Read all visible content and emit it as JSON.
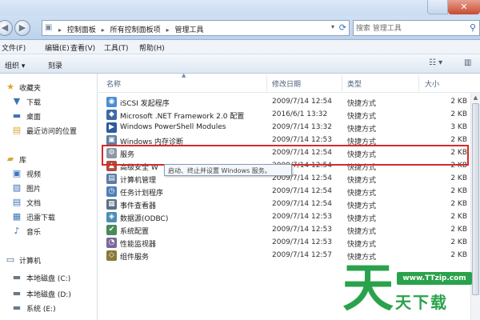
{
  "window": {
    "close_glyph": "✕"
  },
  "address": {
    "crumbs": [
      "控制面板",
      "所有控制面板项",
      "管理工具"
    ],
    "separator": "▸"
  },
  "search": {
    "placeholder": "搜索 管理工具"
  },
  "menu": {
    "items": [
      "文件(F)",
      "编辑(E)",
      "查看(V)",
      "工具(T)",
      "帮助(H)"
    ]
  },
  "commandbar": {
    "organize": "组织 ▾",
    "burn": "刻录"
  },
  "navpane": {
    "favorites": {
      "label": "收藏夹",
      "items": [
        "下载",
        "桌面",
        "最近访问的位置"
      ]
    },
    "libraries": {
      "label": "库",
      "items": [
        "视频",
        "图片",
        "文档",
        "迅雷下载",
        "音乐"
      ]
    },
    "computer": {
      "label": "计算机",
      "items": [
        "本地磁盘 (C:)",
        "本地磁盘 (D:)",
        "系统 (E:)"
      ]
    }
  },
  "columns": {
    "name": "名称",
    "date": "修改日期",
    "type": "类型",
    "size": "大小"
  },
  "files": [
    {
      "name": "iSCSI 发起程序",
      "date": "2009/7/14 12:54",
      "type": "快捷方式",
      "size": "2 KB",
      "icon": "iscsi-icon",
      "color": "#4a8fcf"
    },
    {
      "name": "Microsoft .NET Framework 2.0 配置",
      "date": "2016/6/1 13:32",
      "type": "快捷方式",
      "size": "2 KB",
      "icon": "dotnet-icon",
      "color": "#3e6aa8"
    },
    {
      "name": "Windows PowerShell Modules",
      "date": "2009/7/14 13:32",
      "type": "快捷方式",
      "size": "3 KB",
      "icon": "powershell-icon",
      "color": "#2d5aa0"
    },
    {
      "name": "Windows 内存诊断",
      "date": "2009/7/14 12:53",
      "type": "快捷方式",
      "size": "2 KB",
      "icon": "memory-diagnostic-icon",
      "color": "#5d7f9f"
    },
    {
      "name": "服务",
      "date": "2009/7/14 12:54",
      "type": "快捷方式",
      "size": "2 KB",
      "icon": "services-gear-icon",
      "color": "#8a99a8"
    },
    {
      "name": "高级安全 W",
      "date": "2009/7/14 12:54",
      "type": "快捷方式",
      "size": "2 KB",
      "icon": "firewall-icon",
      "color": "#b34a3a"
    },
    {
      "name": "计算机管理",
      "date": "2009/7/14 12:54",
      "type": "快捷方式",
      "size": "2 KB",
      "icon": "computer-management-icon",
      "color": "#5a7da6"
    },
    {
      "name": "任务计划程序",
      "date": "2009/7/14 12:54",
      "type": "快捷方式",
      "size": "2 KB",
      "icon": "task-scheduler-icon",
      "color": "#4f7fb8"
    },
    {
      "name": "事件查看器",
      "date": "2009/7/14 12:54",
      "type": "快捷方式",
      "size": "2 KB",
      "icon": "event-viewer-icon",
      "color": "#5b6f86"
    },
    {
      "name": "数据源(ODBC)",
      "date": "2009/7/14 12:53",
      "type": "快捷方式",
      "size": "2 KB",
      "icon": "odbc-icon",
      "color": "#4c8fb3"
    },
    {
      "name": "系统配置",
      "date": "2009/7/14 12:53",
      "type": "快捷方式",
      "size": "2 KB",
      "icon": "system-config-icon",
      "color": "#4a8a5a"
    },
    {
      "name": "性能监视器",
      "date": "2009/7/14 12:53",
      "type": "快捷方式",
      "size": "2 KB",
      "icon": "performance-monitor-icon",
      "color": "#7a6a9a"
    },
    {
      "name": "组件服务",
      "date": "2009/7/14 12:57",
      "type": "快捷方式",
      "size": "2 KB",
      "icon": "component-services-icon",
      "color": "#8a7a3a"
    }
  ],
  "tooltip": {
    "text": "启动、终止并设置 Windows 服务。"
  },
  "watermark": {
    "big_char": "天",
    "url": "www.TTzip.com",
    "small_text": "天下载"
  },
  "colors": {
    "highlight_border": "#d32b2b",
    "watermark_green": "#2aa24b"
  }
}
